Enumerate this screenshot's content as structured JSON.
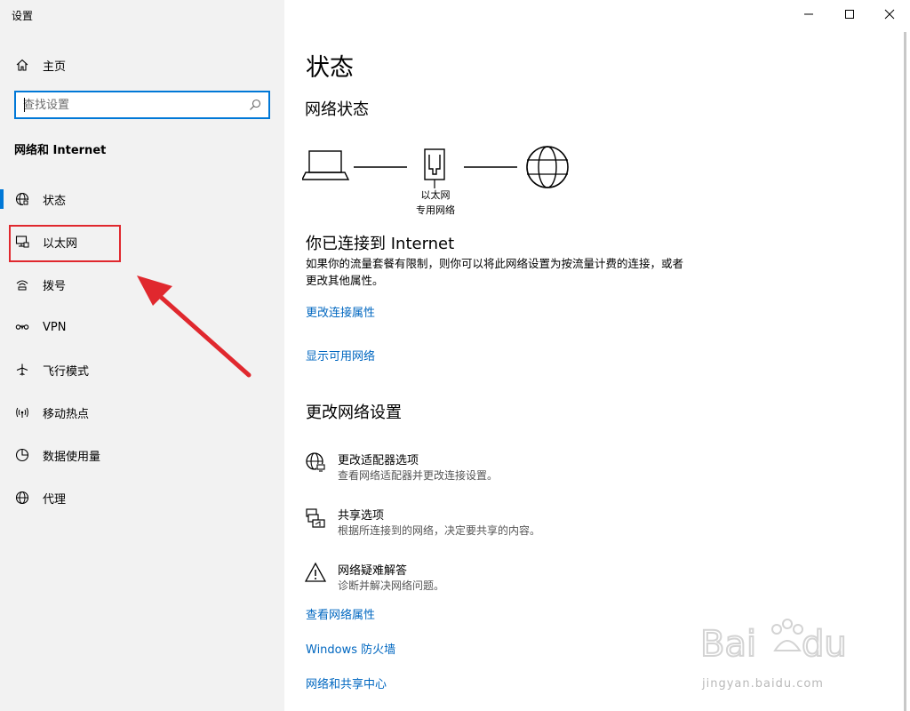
{
  "window": {
    "title": "设置",
    "minimize_label": "",
    "maximize_label": "",
    "close_label": ""
  },
  "sidebar": {
    "home_label": "主页",
    "search_placeholder": "查找设置",
    "section_label": "网络和 Internet",
    "items": [
      {
        "label": "状态",
        "icon": "globe-status-icon",
        "active": true
      },
      {
        "label": "以太网",
        "icon": "ethernet-icon",
        "highlighted": true
      },
      {
        "label": "拨号",
        "icon": "dialup-icon"
      },
      {
        "label": "VPN",
        "icon": "vpn-icon"
      },
      {
        "label": "飞行模式",
        "icon": "airplane-icon"
      },
      {
        "label": "移动热点",
        "icon": "hotspot-icon"
      },
      {
        "label": "数据使用量",
        "icon": "data-usage-icon"
      },
      {
        "label": "代理",
        "icon": "globe-icon"
      }
    ]
  },
  "main": {
    "title": "状态",
    "network_status_heading": "网络状态",
    "diagram": {
      "adapter_name": "以太网",
      "network_type": "专用网络"
    },
    "connected_title": "你已连接到 Internet",
    "connected_desc": "如果你的流量套餐有限制，则你可以将此网络设置为按流量计费的连接，或者更改其他属性。",
    "link_change_connection": "更改连接属性",
    "link_show_networks": "显示可用网络",
    "change_settings_heading": "更改网络设置",
    "options": [
      {
        "title": "更改适配器选项",
        "desc": "查看网络适配器并更改连接设置。",
        "icon": "adapter-globe-icon"
      },
      {
        "title": "共享选项",
        "desc": "根据所连接到的网络，决定要共享的内容。",
        "icon": "sharing-icon"
      },
      {
        "title": "网络疑难解答",
        "desc": "诊断并解决网络问题。",
        "icon": "warning-icon"
      }
    ],
    "link_view_properties": "查看网络属性",
    "link_firewall": "Windows 防火墙",
    "link_sharing_center": "网络和共享中心"
  },
  "watermark": {
    "text": "jingyan.baidu.com"
  },
  "colors": {
    "accent": "#0078d7",
    "link": "#0067c0",
    "annotation_red": "#e0282e",
    "sidebar_bg": "#f2f2f2"
  }
}
